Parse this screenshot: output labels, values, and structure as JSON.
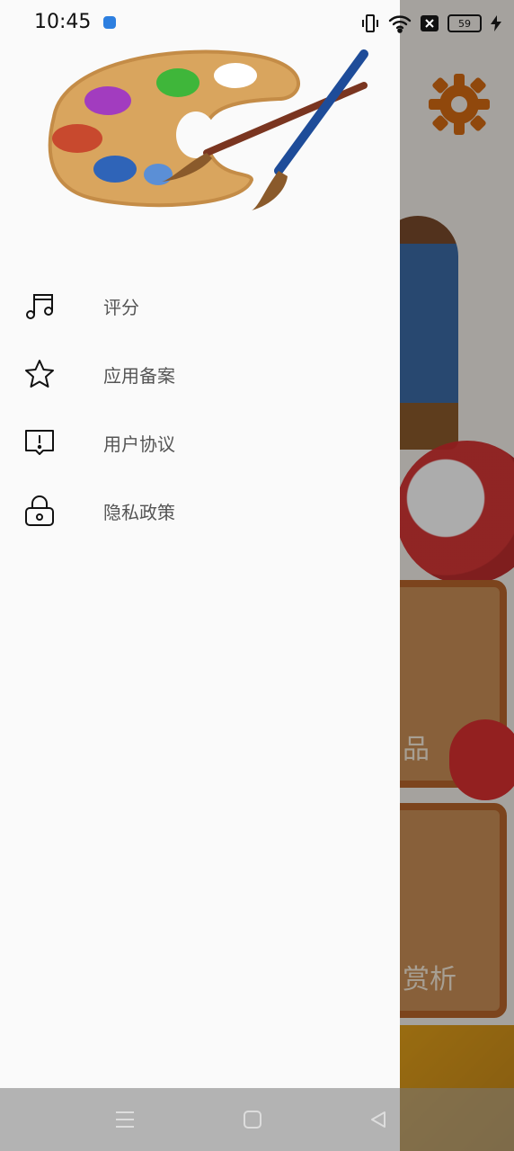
{
  "status_bar": {
    "time": "10:45",
    "battery": "59",
    "icons": [
      "vibrate-icon",
      "wifi-icon",
      "no-sim-icon",
      "battery-icon",
      "charging-icon"
    ]
  },
  "background_app": {
    "card_texts": [
      "品",
      "赏析"
    ]
  },
  "drawer": {
    "menu_items": [
      {
        "label": "评分",
        "icon": "music-note-icon"
      },
      {
        "label": "应用备案",
        "icon": "star-icon"
      },
      {
        "label": "用户协议",
        "icon": "alert-message-icon"
      },
      {
        "label": "隐私政策",
        "icon": "lock-icon"
      }
    ]
  },
  "nav_bar": {
    "buttons": [
      "menu-icon",
      "home-icon",
      "back-icon"
    ]
  }
}
